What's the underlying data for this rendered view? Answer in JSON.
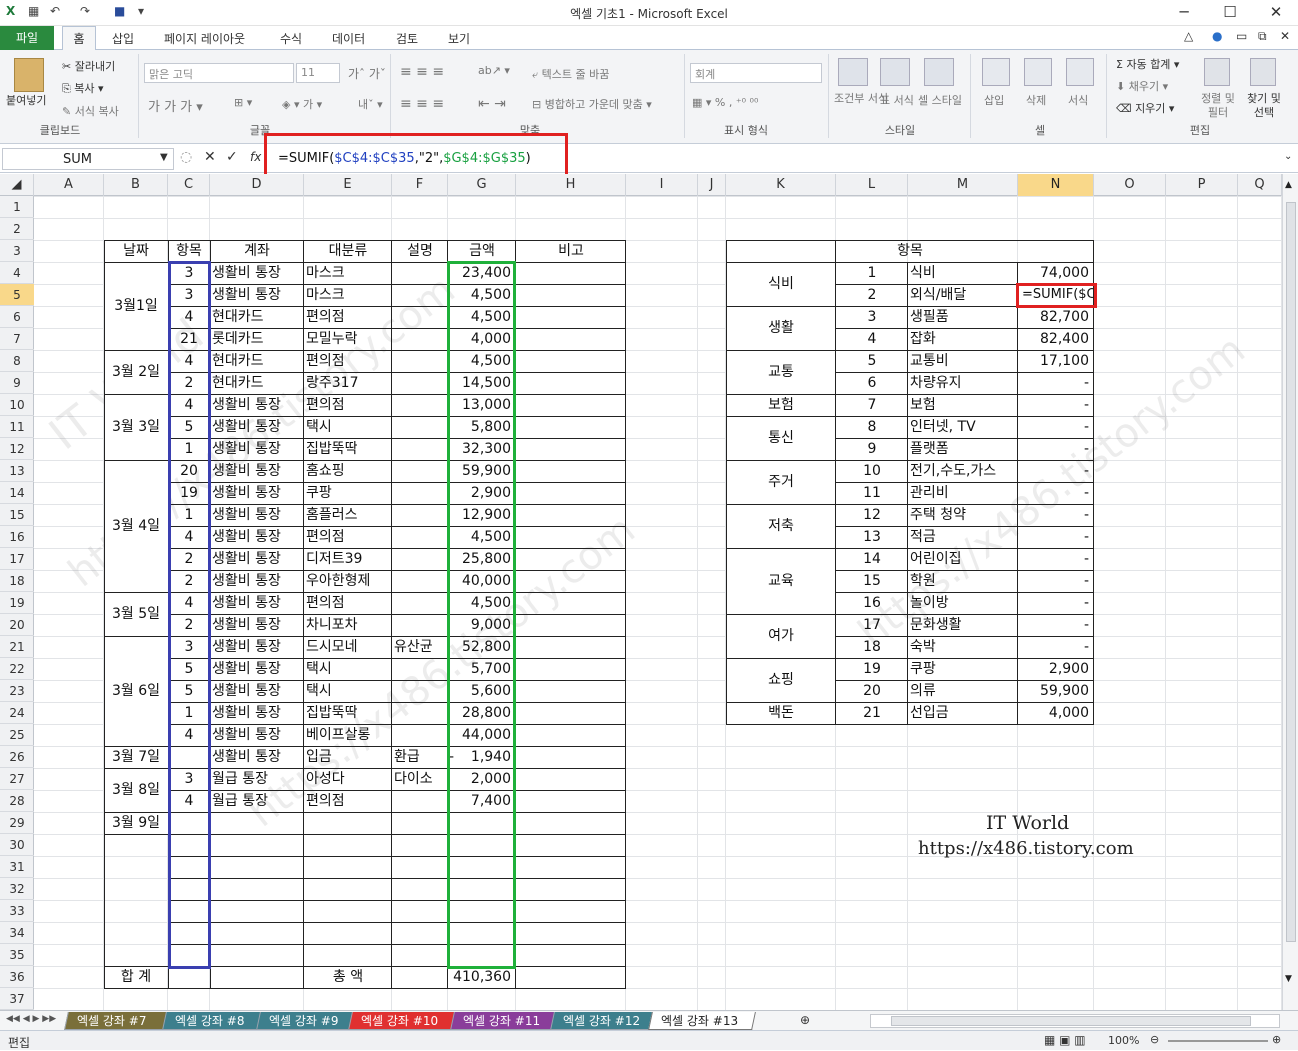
{
  "app": {
    "title": "엑셀 기초1 - Microsoft Excel"
  },
  "ribbon_tabs": [
    "파일",
    "홈",
    "삽입",
    "페이지 레이아웃",
    "수식",
    "데이터",
    "검토",
    "보기"
  ],
  "ribbon": {
    "paste": "붙여넣기",
    "cut": "잘라내기",
    "copy": "복사",
    "format_painter": "서식 복사",
    "clipboard": "클립보드",
    "font_name": "맑은 고딕",
    "font_size": "11",
    "font_group": "글꼴",
    "wrap_text": "텍스트 줄 바꿈",
    "merge_center": "병합하고 가운데 맞춤",
    "align_group": "맞춤",
    "number_format": "회계",
    "number_group": "표시 형식",
    "cond_format": "조건부 서식",
    "table_format": "표 서식",
    "cell_style": "셀 스타일",
    "style_group": "스타일",
    "insert": "삽입",
    "delete": "삭제",
    "format": "서식",
    "cells_group": "셀",
    "autosum": "자동 합계",
    "fill": "채우기",
    "clear": "지우기",
    "sort_filter": "정렬 및 필터",
    "find_select": "찾기 및 선택",
    "edit_group": "편집"
  },
  "formula_bar": {
    "name_box": "SUM",
    "formula": "=SUMIF($C$4:$C$35,\"2\",$G$4:$G$35)"
  },
  "columns": [
    "A",
    "B",
    "C",
    "D",
    "E",
    "F",
    "G",
    "H",
    "I",
    "J",
    "K",
    "L",
    "M",
    "N",
    "O",
    "P",
    "Q"
  ],
  "rows": [
    "1",
    "2",
    "3",
    "4",
    "5",
    "6",
    "7",
    "8",
    "9",
    "10",
    "11",
    "12",
    "13",
    "14",
    "15",
    "16",
    "17",
    "18",
    "19",
    "20",
    "21",
    "22",
    "23",
    "24",
    "25",
    "26",
    "27",
    "28",
    "29",
    "30",
    "31",
    "32",
    "33",
    "34",
    "35",
    "36",
    "37"
  ],
  "left_table": {
    "headers": [
      "날짜",
      "항목",
      "계좌",
      "대분류",
      "설명",
      "금액",
      "비고"
    ],
    "dates": [
      "3월1일",
      "3월 2일",
      "3월 3일",
      "3월 4일",
      "3월 5일",
      "3월 6일",
      "3월 7일",
      "3월 8일",
      "3월 9일"
    ],
    "rows": [
      [
        "3",
        "생활비 통장",
        "마스크",
        "",
        "23,400"
      ],
      [
        "3",
        "생활비 통장",
        "마스크",
        "",
        "4,500"
      ],
      [
        "4",
        "현대카드",
        "편의점",
        "",
        "4,500"
      ],
      [
        "21",
        "롯데카드",
        "모밀누락",
        "",
        "4,000"
      ],
      [
        "4",
        "현대카드",
        "편의점",
        "",
        "4,500"
      ],
      [
        "2",
        "현대카드",
        "랑주317",
        "",
        "14,500"
      ],
      [
        "4",
        "생활비 통장",
        "편의점",
        "",
        "13,000"
      ],
      [
        "5",
        "생활비 통장",
        "택시",
        "",
        "5,800"
      ],
      [
        "1",
        "생활비 통장",
        "집밥뚝딱",
        "",
        "32,300"
      ],
      [
        "20",
        "생활비 통장",
        "홈쇼핑",
        "",
        "59,900"
      ],
      [
        "19",
        "생활비 통장",
        "쿠팡",
        "",
        "2,900"
      ],
      [
        "1",
        "생활비 통장",
        "홈플러스",
        "",
        "12,900"
      ],
      [
        "4",
        "생활비 통장",
        "편의점",
        "",
        "4,500"
      ],
      [
        "2",
        "생활비 통장",
        "디저트39",
        "",
        "25,800"
      ],
      [
        "2",
        "생활비 통장",
        "우아한형제",
        "",
        "40,000"
      ],
      [
        "4",
        "생활비 통장",
        "편의점",
        "",
        "4,500"
      ],
      [
        "2",
        "생활비 통장",
        "차니포차",
        "",
        "9,000"
      ],
      [
        "3",
        "생활비 통장",
        "드시모네",
        "유산균",
        "52,800"
      ],
      [
        "5",
        "생활비 통장",
        "택시",
        "",
        "5,700"
      ],
      [
        "5",
        "생활비 통장",
        "택시",
        "",
        "5,600"
      ],
      [
        "1",
        "생활비 통장",
        "집밥뚝딱",
        "",
        "28,800"
      ],
      [
        "4",
        "생활비 통장",
        "베이프살롱",
        "",
        "44,000"
      ],
      [
        "",
        "생활비 통장",
        "입금",
        "환급",
        "1,940"
      ],
      [
        "3",
        "월급 통장",
        "아성다",
        "다이소",
        "2,000"
      ],
      [
        "4",
        "월급 통장",
        "편의점",
        "",
        "7,400"
      ]
    ],
    "neg_mark": "-",
    "total_label": "합 계",
    "total_amount_label": "총 액",
    "total": "410,360"
  },
  "right_table": {
    "header": "항목",
    "groups": [
      "식비",
      "생활",
      "교통",
      "보험",
      "통신",
      "주거",
      "저축",
      "교육",
      "여가",
      "쇼핑",
      "백돈"
    ],
    "rows": [
      [
        "1",
        "식비",
        "74,000"
      ],
      [
        "2",
        "외식/배달",
        "=SUMIF($C"
      ],
      [
        "3",
        "생필품",
        "82,700"
      ],
      [
        "4",
        "잡화",
        "82,400"
      ],
      [
        "5",
        "교통비",
        "17,100"
      ],
      [
        "6",
        "차량유지",
        "-"
      ],
      [
        "7",
        "보험",
        "-"
      ],
      [
        "8",
        "인터넷, TV",
        "-"
      ],
      [
        "9",
        "플랫폼",
        "-"
      ],
      [
        "10",
        "전기,수도,가스",
        "-"
      ],
      [
        "11",
        "관리비",
        "-"
      ],
      [
        "12",
        "주택 청약",
        "-"
      ],
      [
        "13",
        "적금",
        "-"
      ],
      [
        "14",
        "어린이집",
        "-"
      ],
      [
        "15",
        "학원",
        "-"
      ],
      [
        "16",
        "놀이방",
        "-"
      ],
      [
        "17",
        "문화생활",
        "-"
      ],
      [
        "18",
        "숙박",
        "-"
      ],
      [
        "19",
        "쿠팡",
        "2,900"
      ],
      [
        "20",
        "의류",
        "59,900"
      ],
      [
        "21",
        "선입금",
        "4,000"
      ]
    ]
  },
  "watermark": {
    "line1": "IT World",
    "line2": "https://x486.tistory.com"
  },
  "sheet_tabs": [
    "엑셀 강좌 #7",
    "엑셀 강좌 #8",
    "엑셀 강좌 #9",
    "엑셀 강좌 #10",
    "엑셀 강좌 #11",
    "엑셀 강좌 #12",
    "엑셀 강좌 #13"
  ],
  "sheet_tab_colors": [
    "#7a6f3a",
    "#3d7f8d",
    "#3d7f8d",
    "#e03030",
    "#8a3d9a",
    "#3d7f8d",
    "#ffffff"
  ],
  "status": {
    "mode": "편집",
    "zoom": "100%"
  },
  "colors": {
    "blue_box": "#3a3fb0",
    "green_box": "#1fb03a",
    "red_box": "#e02020",
    "selected_header": "#f9d88a",
    "file_tab": "#2a8a3e"
  }
}
